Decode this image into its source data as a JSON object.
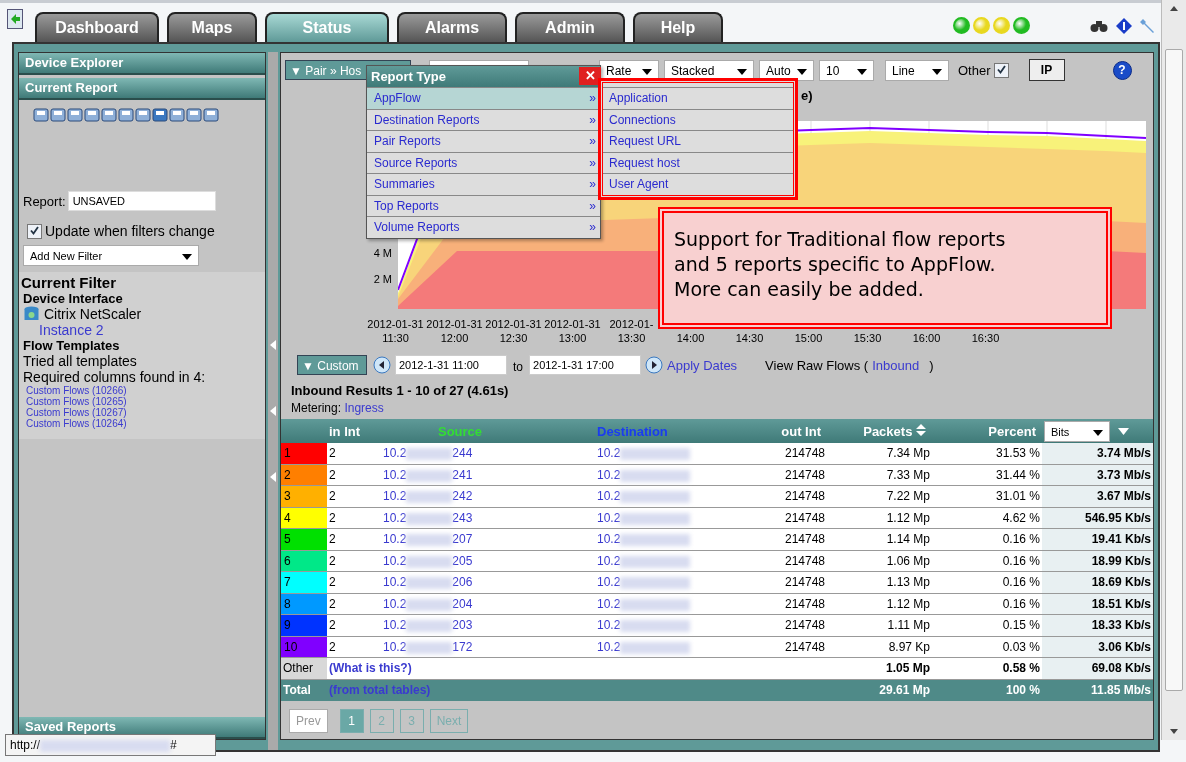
{
  "nav_tabs": [
    {
      "label": "Dashboard",
      "selected": false
    },
    {
      "label": "Maps",
      "selected": false
    },
    {
      "label": "Status",
      "selected": true
    },
    {
      "label": "Alarms",
      "selected": false
    },
    {
      "label": "Admin",
      "selected": false
    },
    {
      "label": "Help",
      "selected": false
    }
  ],
  "status_lights": [
    {
      "color": "#22bb22"
    },
    {
      "color": "#e8d820"
    },
    {
      "color": "#e8d820"
    },
    {
      "color": "#22bb22"
    }
  ],
  "sidebar": {
    "sections": [
      "Device Explorer",
      "Current Report"
    ],
    "report_label": "Report:",
    "report_value": "UNSAVED",
    "update_checkbox": {
      "label": "Update when filters change",
      "checked": true
    },
    "filter_select": "Add New Filter",
    "current_filter": {
      "title": "Current Filter",
      "subtitle": "Device Interface",
      "device": "Citrix NetScaler",
      "instance": "Instance 2",
      "templates_title": "Flow Templates",
      "tried": "Tried all templates",
      "required": "Required columns found in 4:",
      "flows": [
        "Custom Flows (10266)",
        "Custom Flows (10265)",
        "Custom Flows (10267)",
        "Custom Flows (10264)"
      ]
    },
    "saved_reports": "Saved Reports"
  },
  "toolbar": {
    "report_button": "▼ Pair » Hos",
    "selects": [
      "Rate",
      "Stacked",
      "Auto",
      "10",
      "Line"
    ],
    "other": {
      "label": "Other",
      "checked": true
    },
    "ip_button": "IP",
    "help": "?"
  },
  "chart": {
    "title_visible": "e)",
    "y_labels": [
      "4 M",
      "2 M"
    ],
    "x_labels": [
      {
        "date": "2012-01-31",
        "time": "11:30"
      },
      {
        "date": "2012-01-31",
        "time": "12:00"
      },
      {
        "date": "2012-01-31",
        "time": "12:30"
      },
      {
        "date": "2012-01-31",
        "time": "13:00"
      },
      {
        "date": "2012-01-",
        "time": "13:30"
      },
      {
        "time": "14:00"
      },
      {
        "time": "14:30"
      },
      {
        "time": "15:00"
      },
      {
        "time": "15:30"
      },
      {
        "time": "16:00"
      },
      {
        "time": "16:30"
      }
    ]
  },
  "date_range": {
    "button": "▼ Custom",
    "from": "2012-1-31 11:00",
    "to_label": "to",
    "to": "2012-1-31 17:00",
    "apply": "Apply Dates",
    "raw_label": "View Raw Flows (",
    "raw_link": "Inbound",
    "raw_close": ")"
  },
  "results": {
    "summary": "Inbound Results 1 - 10 of 27 (4.61s)",
    "metering_label": "Metering:",
    "metering_value": "Ingress"
  },
  "table": {
    "columns": [
      "in Int",
      "Source",
      "Destination",
      "out Int",
      "Packets",
      "Percent"
    ],
    "unit_select": "Bits",
    "rows": [
      {
        "rank": "1",
        "color": "#ff0000",
        "in_int": "2",
        "source_start": "10.2",
        "source_end": "244",
        "destination_start": "10.2",
        "out_int": "214748",
        "packets": "7.34 Mp",
        "percent": "31.53 %",
        "rate": "3.74 Mb/s"
      },
      {
        "rank": "2",
        "color": "#ff7f00",
        "in_int": "2",
        "source_start": "10.2",
        "source_end": "241",
        "destination_start": "10.2",
        "out_int": "214748",
        "packets": "7.33 Mp",
        "percent": "31.44 %",
        "rate": "3.73 Mb/s"
      },
      {
        "rank": "3",
        "color": "#ffb000",
        "in_int": "2",
        "source_start": "10.2",
        "source_end": "242",
        "destination_start": "10.2",
        "out_int": "214748",
        "packets": "7.22 Mp",
        "percent": "31.01 %",
        "rate": "3.67 Mb/s"
      },
      {
        "rank": "4",
        "color": "#ffff00",
        "in_int": "2",
        "source_start": "10.2",
        "source_end": "243",
        "destination_start": "10.2",
        "out_int": "214748",
        "packets": "1.12 Mp",
        "percent": "4.62 %",
        "rate": "546.95 Kb/s"
      },
      {
        "rank": "5",
        "color": "#00e000",
        "in_int": "2",
        "source_start": "10.2",
        "source_end": "207",
        "destination_start": "10.2",
        "out_int": "214748",
        "packets": "1.14 Mp",
        "percent": "0.16 %",
        "rate": "19.41 Kb/s"
      },
      {
        "rank": "6",
        "color": "#00e888",
        "in_int": "2",
        "source_start": "10.2",
        "source_end": "205",
        "destination_start": "10.2",
        "out_int": "214748",
        "packets": "1.06 Mp",
        "percent": "0.16 %",
        "rate": "18.99 Kb/s"
      },
      {
        "rank": "7",
        "color": "#00ffff",
        "in_int": "2",
        "source_start": "10.2",
        "source_end": "206",
        "destination_start": "10.2",
        "out_int": "214748",
        "packets": "1.13 Mp",
        "percent": "0.16 %",
        "rate": "18.69 Kb/s"
      },
      {
        "rank": "8",
        "color": "#0099ff",
        "in_int": "2",
        "source_start": "10.2",
        "source_end": "204",
        "destination_start": "10.2",
        "out_int": "214748",
        "packets": "1.12 Mp",
        "percent": "0.16 %",
        "rate": "18.51 Kb/s"
      },
      {
        "rank": "9",
        "color": "#0033ff",
        "in_int": "2",
        "source_start": "10.2",
        "source_end": "203",
        "destination_start": "10.2",
        "out_int": "214748",
        "packets": "1.11 Mp",
        "percent": "0.15 %",
        "rate": "18.33 Kb/s"
      },
      {
        "rank": "10",
        "color": "#8000ff",
        "in_int": "2",
        "source_start": "10.2",
        "source_end": "172",
        "destination_start": "10.2",
        "out_int": "214748",
        "packets": "8.97 Kp",
        "percent": "0.03 %",
        "rate": "3.06 Kb/s"
      }
    ],
    "other": {
      "label": "Other",
      "link": "(What is this?)",
      "packets": "1.05 Mp",
      "percent": "0.58 %",
      "rate": "69.08 Kb/s"
    },
    "total": {
      "label": "Total",
      "link": "(from total tables)",
      "packets": "29.61 Mp",
      "percent": "100 %",
      "rate": "11.85 Mb/s"
    }
  },
  "pagination": [
    {
      "label": "Prev",
      "selected": false
    },
    {
      "label": "1",
      "selected": true
    },
    {
      "label": "2",
      "selected": false
    },
    {
      "label": "3",
      "selected": false
    },
    {
      "label": "Next",
      "selected": false
    }
  ],
  "report_menu": {
    "title": "Report Type",
    "close": "✕",
    "items": [
      {
        "label": "AppFlow",
        "selected": true
      },
      {
        "label": "Destination Reports",
        "selected": false
      },
      {
        "label": "Pair Reports",
        "selected": false
      },
      {
        "label": "Source Reports",
        "selected": false
      },
      {
        "label": "Summaries",
        "selected": false
      },
      {
        "label": "Top Reports",
        "selected": false
      },
      {
        "label": "Volume Reports",
        "selected": false
      }
    ],
    "arrow": "»",
    "submenu": [
      "Application",
      "Connections",
      "Request URL",
      "Request host",
      "User Agent"
    ]
  },
  "callout": [
    "Support for Traditional flow reports",
    "and 5 reports specific to AppFlow.",
    "More can easily be added."
  ],
  "status_url": {
    "start": "http://",
    "end": "#"
  }
}
